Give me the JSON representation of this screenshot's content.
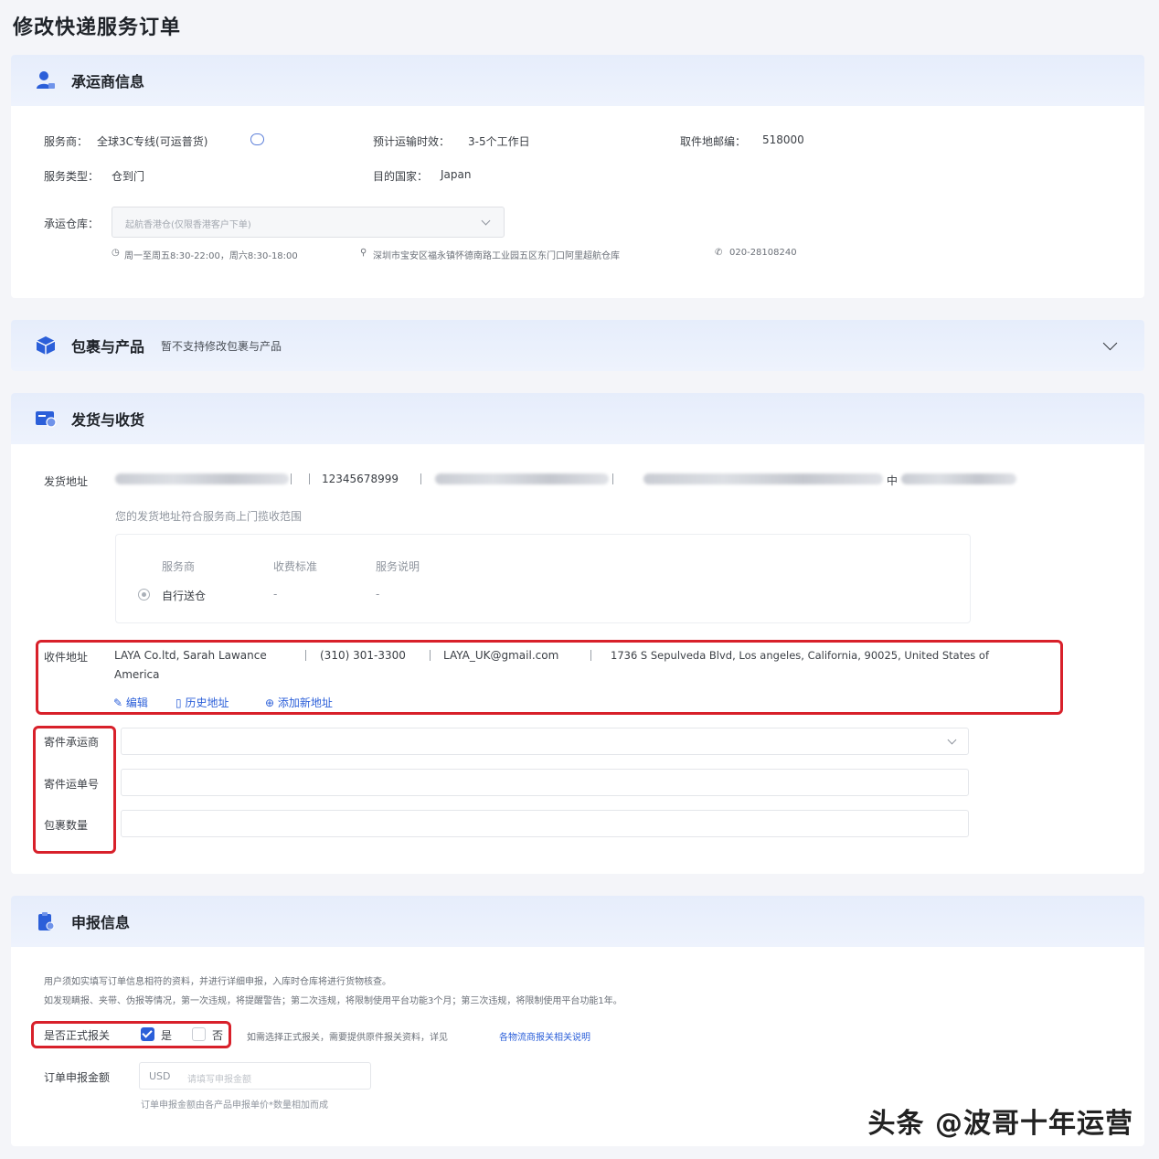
{
  "page": {
    "title": "修改快递服务订单"
  },
  "carrier": {
    "title": "承运商信息",
    "service_provider_label": "服务商：",
    "service_provider_value": "全球3C专线(可运普货)",
    "transit_label": "预计运输时效：",
    "transit_value": "3-5个工作日",
    "pickup_zip_label": "取件地邮编：",
    "pickup_zip_value": "518000",
    "service_type_label": "服务类型：",
    "service_type_value": "仓到门",
    "dest_country_label": "目的国家：",
    "dest_country_value": "Japan",
    "warehouse_label": "承运仓库：",
    "warehouse_value": "起航香港仓(仅限香港客户下单)",
    "warehouse_hours": "周一至周五8:30-22:00，周六8:30-18:00",
    "warehouse_address": "深圳市宝安区福永镇怀德南路工业园五区东门口阿里超航仓库",
    "warehouse_phone": "020-28108240"
  },
  "package": {
    "title": "包裹与产品",
    "note": "暂不支持修改包裹与产品"
  },
  "shipping": {
    "title": "发货与收货",
    "sender_label": "发货地址",
    "sender_phone": "12345678999",
    "sender_city_fragment": "中",
    "pickup_notice": "您的发货地址符合服务商上门揽收范围",
    "table_headers": [
      "服务商",
      "收费标准",
      "服务说明"
    ],
    "table_row": [
      "自行送仓",
      "-",
      "-"
    ],
    "receiver_label": "收件地址",
    "receiver_name": "LAYA Co.ltd, Sarah Lawance",
    "receiver_phone": "(310) 301-3300",
    "receiver_email": "LAYA_UK@gmail.com",
    "receiver_address_line1": "1736 S Sepulveda Blvd, Los angeles, California, 90025, United States of",
    "receiver_address_line2": "America",
    "edit_label": "编辑",
    "history_label": "历史地址",
    "add_label": "添加新地址",
    "carrier_select_label": "寄件承运商",
    "tracking_label": "寄件运单号",
    "package_count_label": "包裹数量"
  },
  "declaration": {
    "title": "申报信息",
    "notice_line1": "用户须如实填写订单信息相符的资料，并进行详细申报，入库时仓库将进行货物核查。",
    "notice_line2": "如发现瞒报、夹带、伪报等情况，第一次违规，将提醒警告；第二次违规，将限制使用平台功能3个月；第三次违规，将限制使用平台功能1年。",
    "formal_customs_label": "是否正式报关",
    "yes_label": "是",
    "no_label": "否",
    "customs_hint": "如需选择正式报关，需要提供原件报关资料，详见",
    "customs_link": "各物流商报关相关说明",
    "amount_label": "订单申报金额",
    "currency": "USD",
    "amount_placeholder": "请填写申报金额",
    "amount_hint": "订单申报金额由各产品申报单价*数量相加而成"
  },
  "watermark": "头条 @波哥十年运营",
  "colors": {
    "accent": "#2b5fd9",
    "highlight_red": "#d8202a",
    "header_bg": "#e6edfb"
  }
}
